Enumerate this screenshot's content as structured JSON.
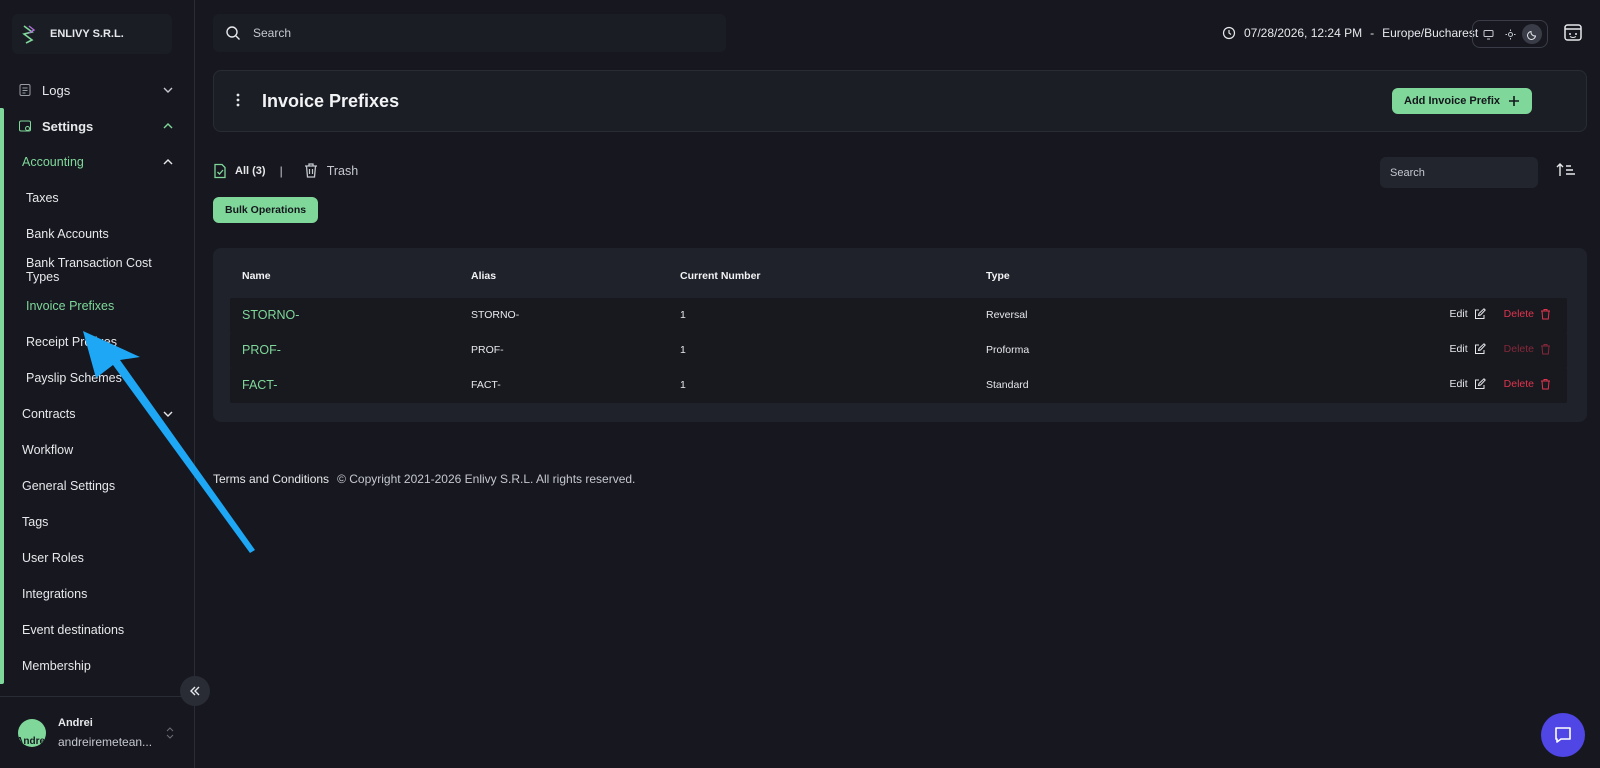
{
  "brand": {
    "name": "ENLIVY S.R.L."
  },
  "sidebar": {
    "logs": "Logs",
    "settings": "Settings",
    "accounting": "Accounting",
    "accounting_items": [
      "Taxes",
      "Bank Accounts",
      "Bank Transaction Cost Types",
      "Invoice Prefixes",
      "Receipt Prefixes",
      "Payslip Schemes"
    ],
    "contracts": "Contracts",
    "items": [
      "Workflow",
      "General Settings",
      "Tags",
      "User Roles",
      "Integrations",
      "Event destinations",
      "Membership"
    ]
  },
  "user": {
    "avatar_text": "Andrei",
    "name": "Andrei",
    "email": "andreiremetean..."
  },
  "topbar": {
    "search_placeholder": "Search",
    "datetime": "07/28/2026, 12:24 PM",
    "separator": "-",
    "timezone": "Europe/Bucharest"
  },
  "header": {
    "title": "Invoice Prefixes",
    "add_label": "Add Invoice Prefix"
  },
  "filters": {
    "all_label": "All (3)",
    "separator": "|",
    "trash_label": "Trash",
    "search_placeholder": "Search",
    "bulk_label": "Bulk Operations"
  },
  "table": {
    "columns": [
      "Name",
      "Alias",
      "Current Number",
      "Type"
    ],
    "edit_label": "Edit",
    "delete_label": "Delete",
    "rows": [
      {
        "name": "STORNO-",
        "alias": "STORNO-",
        "number": "1",
        "type": "Reversal"
      },
      {
        "name": "PROF-",
        "alias": "PROF-",
        "number": "1",
        "type": "Proforma"
      },
      {
        "name": "FACT-",
        "alias": "FACT-",
        "number": "1",
        "type": "Standard"
      }
    ]
  },
  "footer": {
    "terms": "Terms and Conditions",
    "copyright": "© Copyright 2021-2026 Enlivy S.R.L. All rights reserved."
  },
  "colors": {
    "accent": "#7fd89a",
    "danger": "#e0344e",
    "annotation_arrow": "#1ea7f5",
    "chat": "#4f46e5"
  }
}
